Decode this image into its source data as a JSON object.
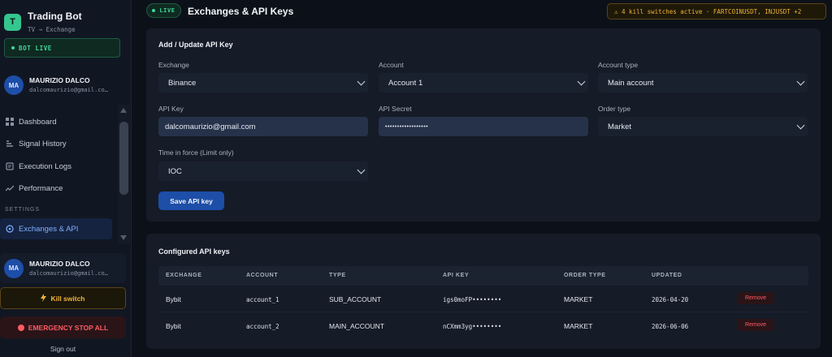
{
  "sidebar": {
    "brand": {
      "logo_letter": "T",
      "title": "Trading Bot",
      "subtitle": "TV → Exchange"
    },
    "bot_status": "BOT LIVE",
    "user": {
      "initials": "MA",
      "name": "MAURIZIO DALCO",
      "email": "dalcomaurizio@gmail.co…"
    },
    "nav": [
      {
        "label": "Dashboard",
        "icon": "grid-icon"
      },
      {
        "label": "Signal History",
        "icon": "signal-icon"
      },
      {
        "label": "Execution Logs",
        "icon": "log-icon"
      },
      {
        "label": "Performance",
        "icon": "trend-icon"
      }
    ],
    "settings_heading": "SETTINGS",
    "settings_items": [
      {
        "label": "Exchanges & API",
        "icon": "plug-icon",
        "active": true
      }
    ],
    "user_card": {
      "initials": "MA",
      "name": "MAURIZIO DALCO",
      "email": "dalcomaurizio@gmail.co…"
    },
    "kill_switch": "Kill switch",
    "emergency_stop": "EMERGENCY STOP ALL",
    "sign_out": "Sign out"
  },
  "header": {
    "live_badge": "LIVE",
    "title": "Exchanges & API Keys",
    "kill_banner": "⚠ 4 kill switches active  ·  FARTCOINUSDT, INJUSDT +2"
  },
  "form": {
    "title": "Add / Update API Key",
    "exchange": {
      "label": "Exchange",
      "value": "Binance"
    },
    "account": {
      "label": "Account",
      "value": "Account 1"
    },
    "account_type": {
      "label": "Account type",
      "value": "Main account"
    },
    "api_key": {
      "label": "API Key",
      "value": "dalcomaurizio@gmail.com"
    },
    "api_secret": {
      "label": "API Secret",
      "value": "••••••••••••••••••"
    },
    "order_type": {
      "label": "Order type",
      "value": "Market"
    },
    "time_in_force": {
      "label": "Time in force (Limit only)",
      "value": "IOC"
    },
    "save_label": "Save API key"
  },
  "keys": {
    "title": "Configured API keys",
    "columns": [
      "EXCHANGE",
      "ACCOUNT",
      "TYPE",
      "API KEY",
      "ORDER TYPE",
      "UPDATED"
    ],
    "rows": [
      {
        "exchange": "Bybit",
        "account": "account_1",
        "type": "SUB_ACCOUNT",
        "api_key": "igs0moFP••••••••",
        "order_type": "MARKET",
        "updated": "2026-04-20",
        "action": "Remove"
      },
      {
        "exchange": "Bybit",
        "account": "account_2",
        "type": "MAIN_ACCOUNT",
        "api_key": "nCXmm3yg••••••••",
        "order_type": "MARKET",
        "updated": "2026-06-06",
        "action": "Remove"
      }
    ]
  },
  "colors": {
    "accent_green": "#43d69a",
    "accent_blue": "#1d4ea8",
    "warning": "#f0b43a",
    "danger": "#ff5b63"
  }
}
